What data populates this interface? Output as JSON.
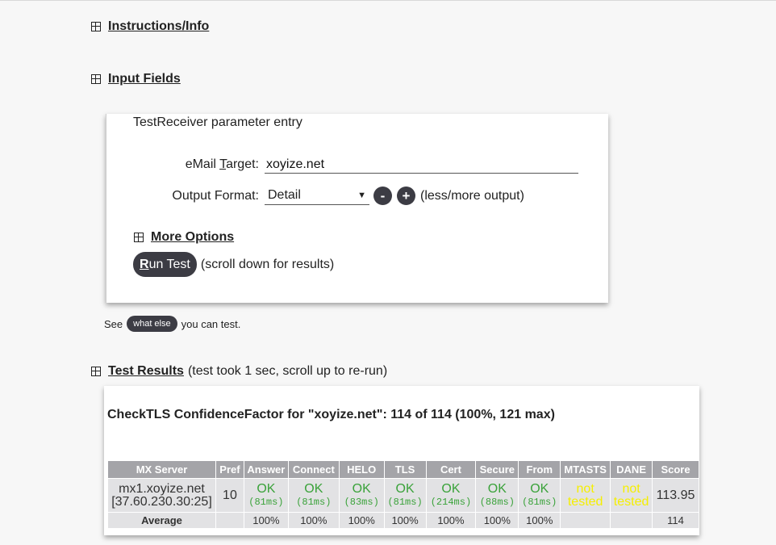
{
  "sections": {
    "instructions": "Instructions/Info",
    "input_fields": "Input Fields",
    "test_results": "Test Results",
    "test_results_note": "(test took 1 sec, scroll up to re-run)"
  },
  "input": {
    "title": "TestReceiver parameter entry",
    "email_label_pre": "eMail ",
    "email_label_key": "T",
    "email_label_post": "arget:",
    "email_value": "xoyize.net",
    "output_label": "Output Format:",
    "output_value": "Detail",
    "minus": "-",
    "plus": "+",
    "less_more": "(less/more output)",
    "more_options": "More Options",
    "run_key": "R",
    "run_rest": "un Test",
    "run_note": "(scroll down for results)"
  },
  "see": {
    "pre": "See",
    "pill": "what else",
    "post": "you can test."
  },
  "results": {
    "title": "CheckTLS ConfidenceFactor for \"xoyize.net\": 114 of 114 (100%, 121 max)",
    "headers": [
      "MX Server",
      "Pref",
      "Answer",
      "Connect",
      "HELO",
      "TLS",
      "Cert",
      "Secure",
      "From",
      "MTASTS",
      "DANE",
      "Score"
    ],
    "row": {
      "server": "mx1.xoyize.net",
      "ip": "[37.60.230.30:25]",
      "pref": "10",
      "checks": [
        {
          "status": "OK",
          "time": "(81ms)"
        },
        {
          "status": "OK",
          "time": "(81ms)"
        },
        {
          "status": "OK",
          "time": "(83ms)"
        },
        {
          "status": "OK",
          "time": "(81ms)"
        },
        {
          "status": "OK",
          "time": "(214ms)"
        },
        {
          "status": "OK",
          "time": "(88ms)"
        },
        {
          "status": "OK",
          "time": "(81ms)"
        }
      ],
      "mtasts": "not tested",
      "dane": "not tested",
      "score": "113.95"
    },
    "average": {
      "label": "Average",
      "values": [
        "100%",
        "100%",
        "100%",
        "100%",
        "100%",
        "100%",
        "100%"
      ],
      "score": "114"
    }
  },
  "colors": {
    "ok": "#3aa23a",
    "not_tested": "#f5ef00",
    "button": "#3c3c44",
    "header": "#a4a4a8"
  }
}
